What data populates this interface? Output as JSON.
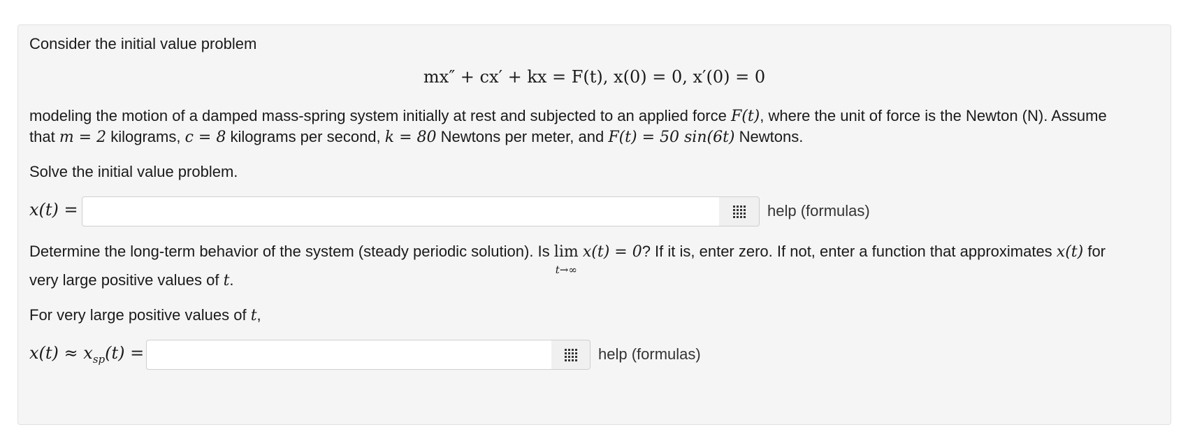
{
  "problem": {
    "intro": "Consider the initial value problem",
    "equation": "mx″ + cx′ + kx = F(t),   x(0) = 0,   x′(0) = 0",
    "para1_a": "modeling the motion of a damped mass-spring system initially at rest and subjected to an applied force ",
    "F_t": "F(t)",
    "para1_b": ", where the unit of force is the Newton (N). Assume",
    "para2_a": "that ",
    "m_eq": "m = 2",
    "para2_b": " kilograms, ",
    "c_eq": "c = 8",
    "para2_c": " kilograms per second, ",
    "k_eq": "k = 80",
    "para2_d": " Newtons per meter, and ",
    "F_eq": "F(t) = 50 sin(6t)",
    "para2_e": " Newtons.",
    "solve": "Solve the initial value problem."
  },
  "answer1": {
    "label": "x(t) =",
    "value": "",
    "help": "help (formulas)"
  },
  "longterm": {
    "text_a": "Determine the long-term behavior of the system (steady periodic solution). Is ",
    "lim": "lim",
    "lim_sub": "t→∞",
    "lim_expr": "x(t) = 0",
    "text_b": "? If it is, enter zero. If not, enter a function that approximates ",
    "x_t": "x(t)",
    "text_c": " for",
    "line2_a": "very large positive values of ",
    "t": "t",
    "line2_b": ".",
    "for_large_a": "For very large positive values of ",
    "for_large_t": "t",
    "for_large_b": ","
  },
  "answer2": {
    "label": "x(t) ≈ x",
    "label_sub": "sp",
    "label_end": "(t) =",
    "value": "",
    "help": "help (formulas)"
  }
}
